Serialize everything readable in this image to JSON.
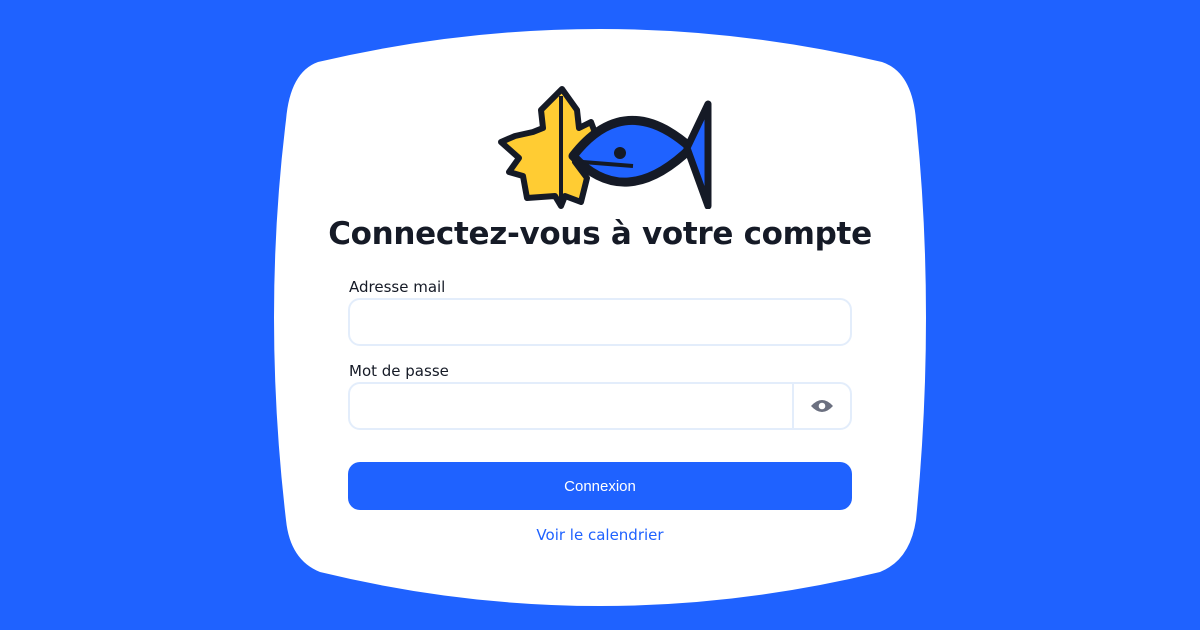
{
  "colors": {
    "background": "#1f62ff",
    "accent": "#1f62ff",
    "card": "#ffffff",
    "leaf": "#ffcc33",
    "fish": "#1f62ff",
    "outline": "#151a26"
  },
  "logo": {
    "icon": "maple-leaf-fish-logo"
  },
  "title": "Connectez-vous à votre compte",
  "email": {
    "label": "Adresse mail",
    "value": "",
    "placeholder": ""
  },
  "password": {
    "label": "Mot de passe",
    "value": "",
    "placeholder": "",
    "toggle_icon": "eye-icon"
  },
  "submit_label": "Connexion",
  "calendar_link": "Voir le calendrier"
}
